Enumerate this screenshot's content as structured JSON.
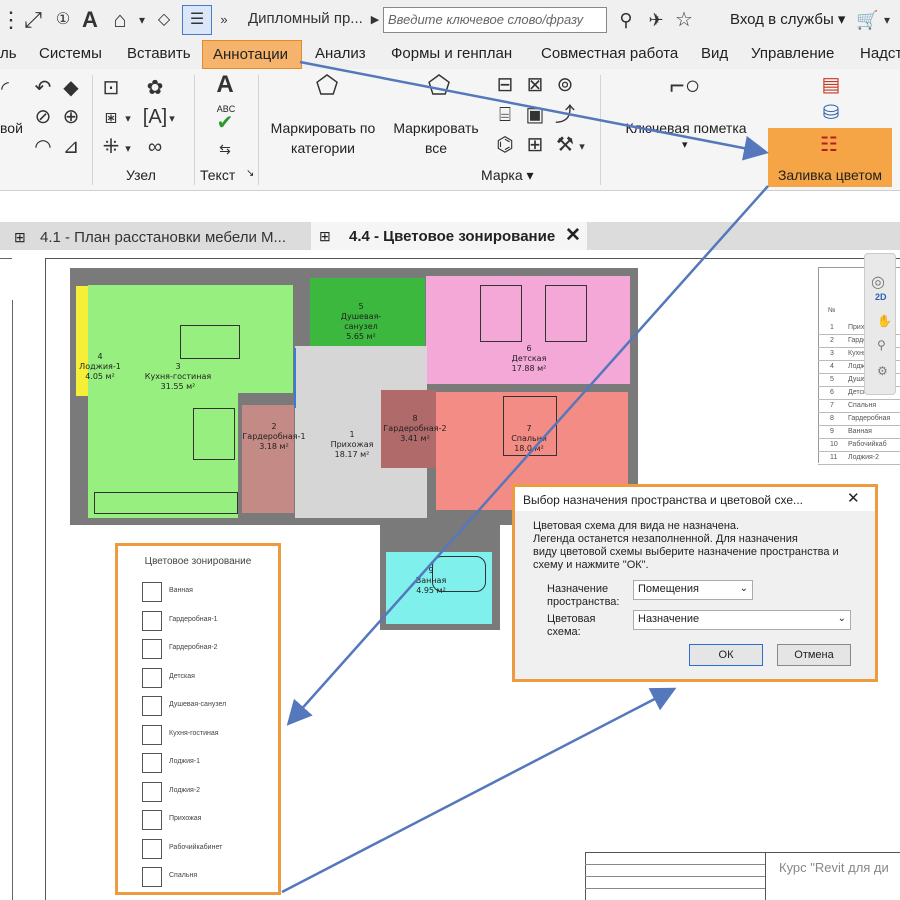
{
  "qat": {
    "doc_title": "Дипломный пр...",
    "search_placeholder": "Введите ключевое слово/фразу",
    "signin": "Вход в службы"
  },
  "menu": {
    "tabs": [
      "ль",
      "Системы",
      "Вставить",
      "Аннотации",
      "Анализ",
      "Формы и генплан",
      "Совместная работа",
      "Вид",
      "Управление",
      "Надст"
    ],
    "active": "Аннотации"
  },
  "ribbon": {
    "left_partial_label": "вой",
    "panel_node": "Узел",
    "panel_text": "Текст",
    "panel_tag": "Марка",
    "tag_by_category": "Маркировать по категории",
    "tag_all": "Маркировать все",
    "keynote": "Ключевая пометка",
    "color_fill": "Заливка цветом",
    "abc_label": "ABC"
  },
  "view_tabs": {
    "tab1": "4.1 - План расстановки мебели М...",
    "tab2": "4.4 - Цветовое зонирование"
  },
  "rooms": [
    {
      "num": "4",
      "name": "Лоджия-1",
      "area": "4.05 м²",
      "color": "#f5ef38"
    },
    {
      "num": "3",
      "name": "Кухня-гостиная",
      "area": "31.55 м²",
      "color": "#97ef7f"
    },
    {
      "num": "5",
      "name": "Душевая-санузел",
      "area": "5.65 м²",
      "color": "#3cb83e"
    },
    {
      "num": "6",
      "name": "Детская",
      "area": "17.88 м²",
      "color": "#f4a8d8"
    },
    {
      "num": "2",
      "name": "Гардеробная-1",
      "area": "3.18 м²",
      "color": "#c48a86"
    },
    {
      "num": "1",
      "name": "Прихожая",
      "area": "18.17 м²",
      "color": "#d6d6d6"
    },
    {
      "num": "8",
      "name": "Гардеробная-2",
      "area": "3.41 м²",
      "color": "#b06a6a"
    },
    {
      "num": "7",
      "name": "Спальня",
      "area": "18.0 м²",
      "color": "#f48c86"
    },
    {
      "num": "9",
      "name": "Ванная",
      "area": "4.95 м²",
      "color": "#7ff0ec"
    }
  ],
  "legend": {
    "title": "Цветовое зонирование",
    "items": [
      "Ванная",
      "Гардеробная-1",
      "Гардеробная-2",
      "Детская",
      "Душевая-санузел",
      "Кухня-гостиная",
      "Лоджия-1",
      "Лоджия-2",
      "Прихожая",
      "Рабочийкабинет",
      "Спальня"
    ]
  },
  "schedule": {
    "header": "№",
    "rows": [
      {
        "n": "1",
        "name": "Прихожая"
      },
      {
        "n": "2",
        "name": "Гардеробная"
      },
      {
        "n": "3",
        "name": "Кухня-гост"
      },
      {
        "n": "4",
        "name": "Лоджия-1"
      },
      {
        "n": "5",
        "name": "Душевая-сан"
      },
      {
        "n": "6",
        "name": "Детская"
      },
      {
        "n": "7",
        "name": "Спальня"
      },
      {
        "n": "8",
        "name": "Гардеробная"
      },
      {
        "n": "9",
        "name": "Ванная"
      },
      {
        "n": "10",
        "name": "Рабочийкаб"
      },
      {
        "n": "11",
        "name": "Лоджия-2"
      }
    ]
  },
  "dialog": {
    "title": "Выбор назначения пространства и цветовой схе...",
    "message_1": "Цветовая схема для вида не назначена.",
    "message_2": "Легенда останется незаполненной.  Для назначения",
    "message_3": "виду цветовой схемы выберите назначение пространства и",
    "message_4": "схему и нажмите \"ОК\".",
    "space_label_1": "Назначение",
    "space_label_2": "пространства:",
    "space_value": "Помещения",
    "scheme_label_1": "Цветовая",
    "scheme_label_2": "схема:",
    "scheme_value": "Назначение",
    "ok": "ОК",
    "cancel": "Отмена"
  },
  "title_block": {
    "course": "Курс \"Revit для ди"
  },
  "nav": {
    "view_2d": "2D"
  },
  "colors": {
    "accent_orange": "#ee9a3e",
    "arrow_blue": "#5577bb"
  }
}
